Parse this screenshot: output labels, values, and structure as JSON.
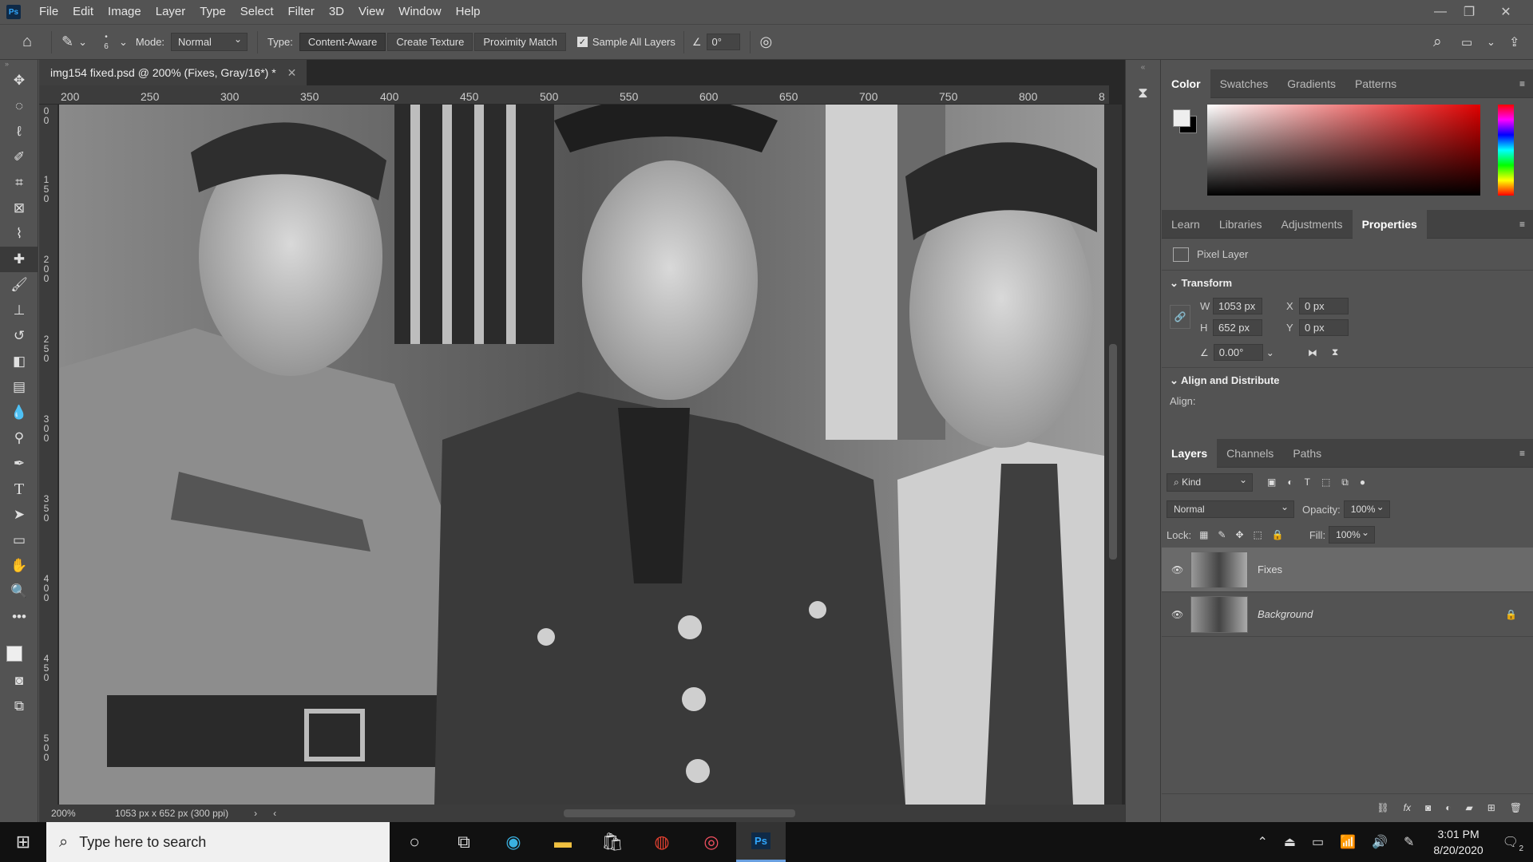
{
  "menu": {
    "items": [
      "File",
      "Edit",
      "Image",
      "Layer",
      "Type",
      "Select",
      "Filter",
      "3D",
      "View",
      "Window",
      "Help"
    ],
    "logo": "Ps"
  },
  "options": {
    "brush_size": "6",
    "mode_label": "Mode:",
    "mode_value": "Normal",
    "type_label": "Type:",
    "type_buttons": [
      "Content-Aware",
      "Create Texture",
      "Proximity Match"
    ],
    "sample_all_label": "Sample All Layers",
    "sample_all_checked": true,
    "angle_value": "0°"
  },
  "document": {
    "tab_title": "img154 fixed.psd @ 200% (Fixes, Gray/16*) *",
    "ruler_top": [
      "200",
      "250",
      "300",
      "350",
      "400",
      "450",
      "500",
      "550",
      "600",
      "650",
      "700",
      "750",
      "800",
      "8"
    ],
    "ruler_left": [
      "0\n0",
      "1\n5\n0",
      "2\n0\n0",
      "2\n5\n0",
      "3\n0\n0",
      "3\n5\n0",
      "4\n0\n0",
      "4\n5\n0",
      "5\n0\n0"
    ],
    "zoom": "200%",
    "doc_info": "1053 px x 652 px (300 ppi)"
  },
  "color_panel": {
    "tabs": [
      "Color",
      "Swatches",
      "Gradients",
      "Patterns"
    ],
    "active": "Color"
  },
  "properties_panel": {
    "tabs": [
      "Learn",
      "Libraries",
      "Adjustments",
      "Properties"
    ],
    "active": "Properties",
    "layer_type": "Pixel Layer",
    "transform_title": "Transform",
    "w_label": "W",
    "w_value": "1053 px",
    "h_label": "H",
    "h_value": "652 px",
    "x_label": "X",
    "x_value": "0 px",
    "y_label": "Y",
    "y_value": "0 px",
    "angle_value": "0.00°",
    "align_title": "Align and Distribute",
    "align_label": "Align:"
  },
  "layers_panel": {
    "tabs": [
      "Layers",
      "Channels",
      "Paths"
    ],
    "active": "Layers",
    "filter_kind": "Kind",
    "blend_mode": "Normal",
    "opacity_label": "Opacity:",
    "opacity_value": "100%",
    "lock_label": "Lock:",
    "fill_label": "Fill:",
    "fill_value": "100%",
    "layers": [
      {
        "name": "Fixes",
        "selected": true,
        "locked": false
      },
      {
        "name": "Background",
        "selected": false,
        "locked": true
      }
    ]
  },
  "taskbar": {
    "search_placeholder": "Type here to search",
    "time": "3:01 PM",
    "date": "8/20/2020",
    "notifications": "2"
  }
}
